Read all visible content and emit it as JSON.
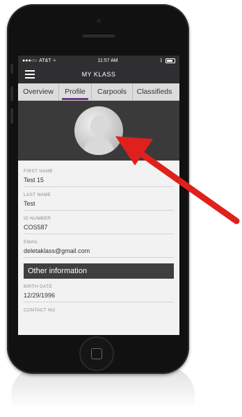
{
  "status_bar": {
    "carrier": "AT&T",
    "time": "11:57 AM"
  },
  "nav": {
    "title": "MY KLASS",
    "menu_icon": "hamburger-menu-icon"
  },
  "tabs": [
    {
      "label": "Overview",
      "active": false
    },
    {
      "label": "Profile",
      "active": true
    },
    {
      "label": "Carpools",
      "active": false
    },
    {
      "label": "Classifieds",
      "active": false
    }
  ],
  "profile": {
    "avatar_icon": "user-silhouette-icon"
  },
  "fields": [
    {
      "label": "FIRST NAME",
      "value": "Test 15"
    },
    {
      "label": "LAST NAME",
      "value": "Test"
    },
    {
      "label": "ID NUMBER",
      "value": "COS587"
    },
    {
      "label": "EMAIL",
      "value": "deletaklass@gmail.com"
    }
  ],
  "section": {
    "title": "Other information"
  },
  "other_fields": [
    {
      "label": "BIRTH DATE",
      "value": "12/29/1996"
    },
    {
      "label": "CONTACT NO",
      "value": ""
    }
  ],
  "colors": {
    "nav_bg": "#2f2f31",
    "tab_accent": "#6a3b8a",
    "arrow": "#e0201c"
  }
}
